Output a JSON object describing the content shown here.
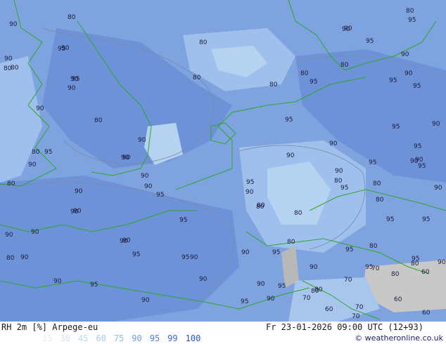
{
  "header": {
    "product_label": "RH 2m [%] Arpege-eu",
    "valid_time": "Fr 23-01-2026 09:00 UTC (12+93)"
  },
  "legend": {
    "items": [
      {
        "value": "15",
        "color": "#e6eef6"
      },
      {
        "value": "30",
        "color": "#d2e4f0"
      },
      {
        "value": "45",
        "color": "#bcd8ec"
      },
      {
        "value": "60",
        "color": "#a6cceb"
      },
      {
        "value": "75",
        "color": "#8cbde8"
      },
      {
        "value": "90",
        "color": "#6f9fe6"
      },
      {
        "value": "95",
        "color": "#4f7fe6"
      },
      {
        "value": "99",
        "color": "#3a6ae0"
      },
      {
        "value": "100",
        "color": "#2a55d8"
      }
    ]
  },
  "credit": "© weatheronline.co.uk",
  "map": {
    "colors": {
      "rh_90_plus": "#7fa3de",
      "rh_95_plus": "#6e92d8",
      "rh_80": "#9fc0ec",
      "rh_70": "#b5d3f0",
      "dry_land_grey": "#c8c8c8",
      "coastline": "#2aa82a",
      "contour_line": "#7a8aa8"
    },
    "contour_labels": [
      "80",
      "90",
      "95",
      "90",
      "80",
      "80",
      "90",
      "90",
      "80",
      "80",
      "90",
      "95",
      "90",
      "80",
      "80",
      "95",
      "90",
      "95",
      "80",
      "90",
      "95",
      "90",
      "95",
      "80",
      "95",
      "80",
      "90",
      "95",
      "90",
      "80",
      "95",
      "90",
      "95",
      "80",
      "90",
      "90",
      "95",
      "90",
      "90",
      "95",
      "80",
      "80",
      "95",
      "90",
      "90",
      "80",
      "90",
      "80",
      "90",
      "90",
      "95",
      "90",
      "80",
      "90",
      "95",
      "80",
      "95",
      "95",
      "90",
      "80",
      "95",
      "90",
      "80",
      "90",
      "95",
      "95",
      "90",
      "90",
      "95",
      "90",
      "95",
      "95",
      "90",
      "70",
      "80",
      "95",
      "90",
      "70",
      "80",
      "70",
      "90",
      "60",
      "80",
      "60",
      "70",
      "60",
      "70",
      "60",
      "90",
      "95",
      "90",
      "90",
      "95",
      "80",
      "95",
      "90",
      "90",
      "90",
      "90",
      "95",
      "90",
      "80",
      "90"
    ]
  }
}
